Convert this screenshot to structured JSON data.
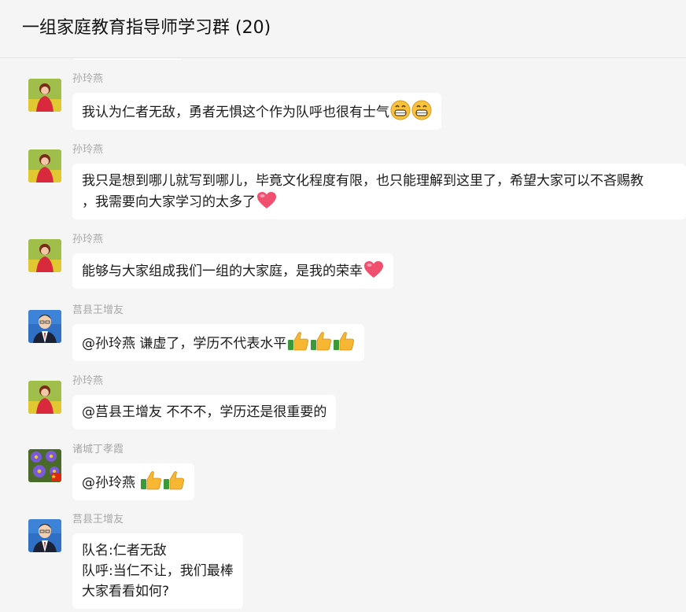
{
  "chat": {
    "title": "一组家庭教育指导师学习群 (20)"
  },
  "messages": [
    {
      "sender": "孙玲燕",
      "text": "我认为仁者无敌，勇者无惧这个作为队呼也很有士气",
      "emojis": [
        "grinning-face-icon",
        "grinning-face-icon"
      ]
    },
    {
      "sender": "孙玲燕",
      "lines": [
        "我只是想到哪儿就写到哪儿，毕竟文化程度有限，也只能理解到这里了，希望大家可以不吝赐教",
        "，我需要向大家学习的太多了"
      ],
      "emojis": [
        "heart-icon"
      ]
    },
    {
      "sender": "孙玲燕",
      "text": "能够与大家组成我们一组的大家庭，是我的荣幸",
      "emojis": [
        "heart-icon"
      ]
    },
    {
      "sender": "莒县王增友",
      "text": "@孙玲燕 谦虚了，学历不代表水平",
      "emojis": [
        "thumbs-up-icon",
        "thumbs-up-icon",
        "thumbs-up-icon"
      ]
    },
    {
      "sender": "孙玲燕",
      "text": "@莒县王增友 不不不，学历还是很重要的",
      "emojis": []
    },
    {
      "sender": "诸城丁孝霞",
      "text": "@孙玲燕 ",
      "emojis": [
        "thumbs-up-icon",
        "thumbs-up-icon"
      ]
    },
    {
      "sender": "莒县王增友",
      "lines": [
        "队名:仁者无敌",
        "队呼:当仁不让，我们最棒",
        "大家看看如何?"
      ],
      "emojis": []
    }
  ],
  "colors": {
    "background": "#f5f5f5",
    "bubble": "#ffffff",
    "sender_name": "#a8a8a8",
    "heart": "#f0506e",
    "thumb": "#f7b733"
  }
}
